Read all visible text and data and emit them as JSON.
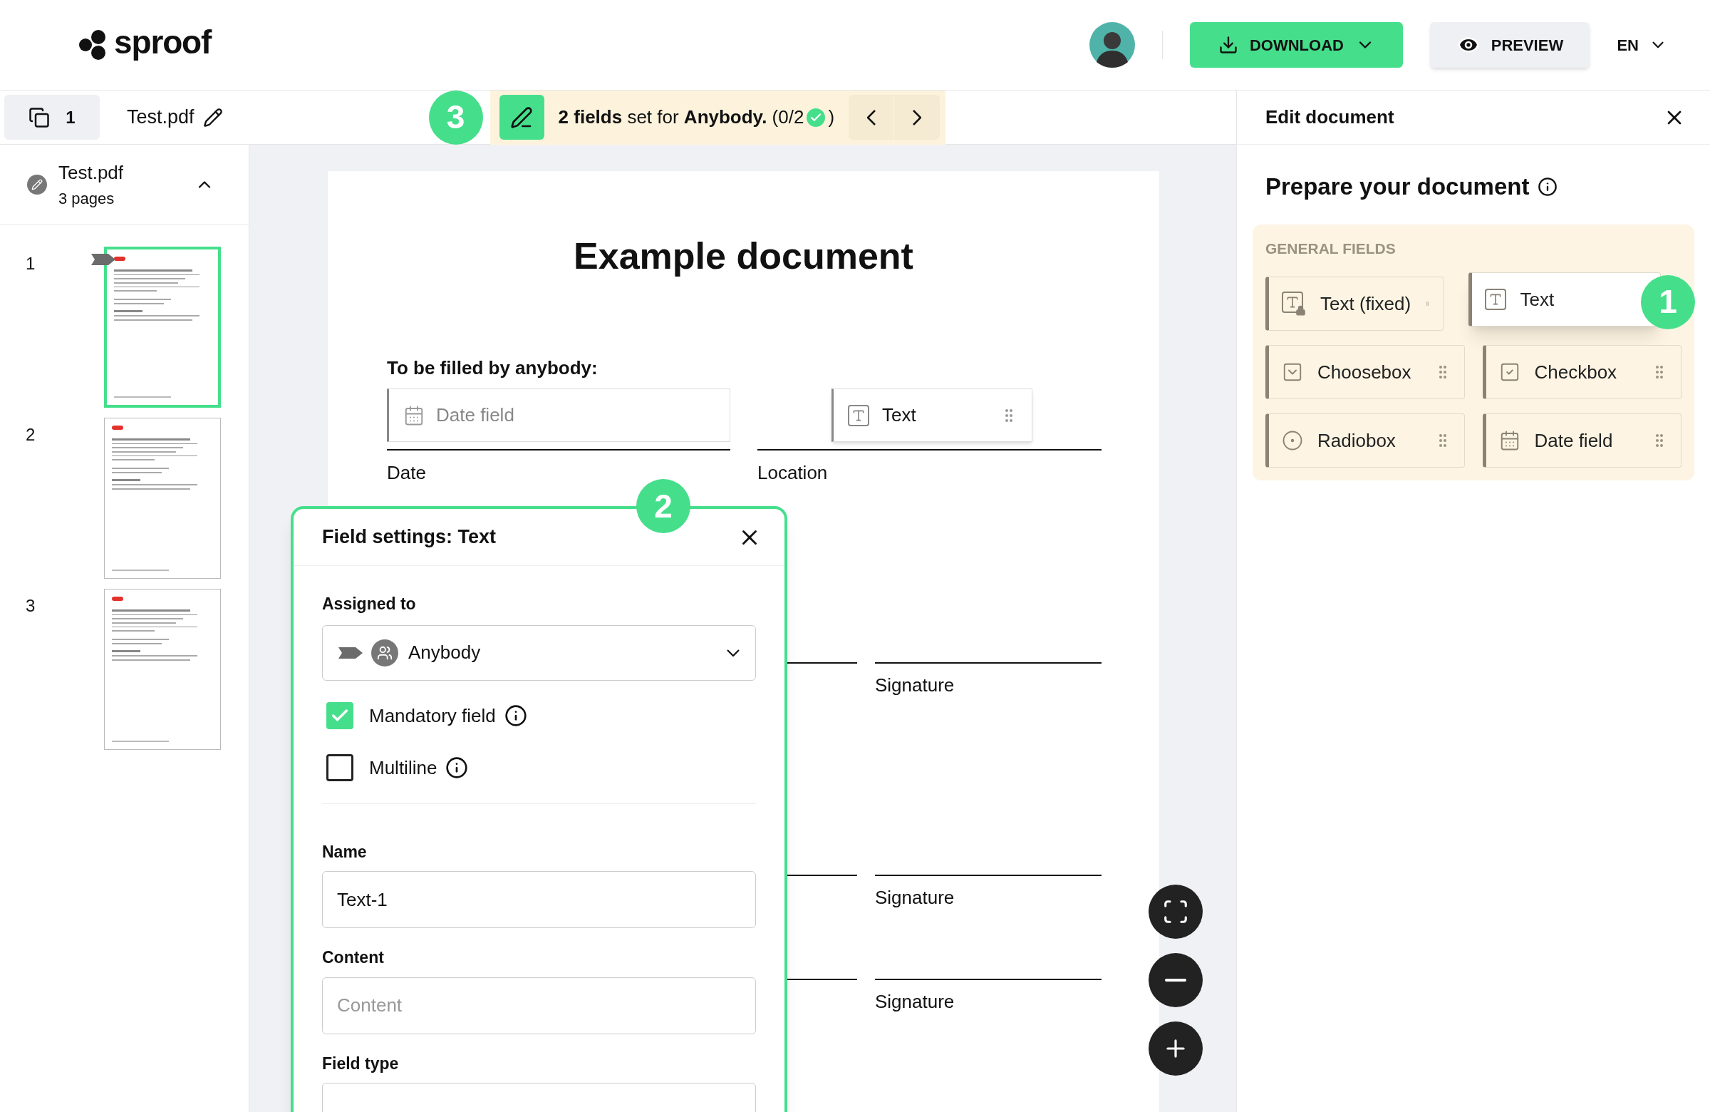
{
  "header": {
    "logo": "sproof",
    "download": "DOWNLOAD",
    "preview": "PREVIEW",
    "language": "EN"
  },
  "toolbar": {
    "page_count": "1",
    "file_name": "Test.pdf",
    "step_badge": "3",
    "notice": "**2 fields** set for **Anybody.** (0/2",
    "notice_end": ")"
  },
  "sidebar": {
    "file_name": "Test.pdf",
    "pages_label": "3 pages",
    "expanded": true,
    "pages": [
      {
        "number": "1",
        "selected": true,
        "marker": true
      },
      {
        "number": "2",
        "selected": false,
        "marker": false
      },
      {
        "number": "3",
        "selected": false,
        "marker": false
      }
    ]
  },
  "document": {
    "title": "Example document",
    "subtitle": "To be filled by anybody:",
    "fields": [
      {
        "kind": "date",
        "placeholder": "Date field",
        "caption": "Date"
      },
      {
        "kind": "text",
        "label": "Text",
        "caption": "Location"
      }
    ],
    "signatures": [
      "Signature",
      "Signature",
      "Signature"
    ]
  },
  "dialog": {
    "title": "Field settings: Text",
    "step_badge": "2",
    "assigned_label": "Assigned to",
    "assigned_value": "Anybody",
    "options": [
      {
        "label": "Mandatory field",
        "checked": true
      },
      {
        "label": "Multiline",
        "checked": false
      }
    ],
    "name_label": "Name",
    "name_value": "Text-1",
    "content_label": "Content",
    "content_placeholder": "Content",
    "field_type_label": "Field type"
  },
  "edit_panel": {
    "title": "Edit document",
    "heading": "Prepare your document",
    "section": "GENERAL FIELDS",
    "step_badge": "1",
    "items": [
      {
        "kind": "text_fixed",
        "label": "Text (fixed)",
        "dragging": false
      },
      {
        "kind": "text",
        "label": "Text",
        "dragging": true
      },
      {
        "kind": "choosebox",
        "label": "Choosebox",
        "dragging": false
      },
      {
        "kind": "checkbox",
        "label": "Checkbox",
        "dragging": false
      },
      {
        "kind": "radiobox",
        "label": "Radiobox",
        "dragging": false
      },
      {
        "kind": "date",
        "label": "Date field",
        "dragging": false
      }
    ]
  }
}
